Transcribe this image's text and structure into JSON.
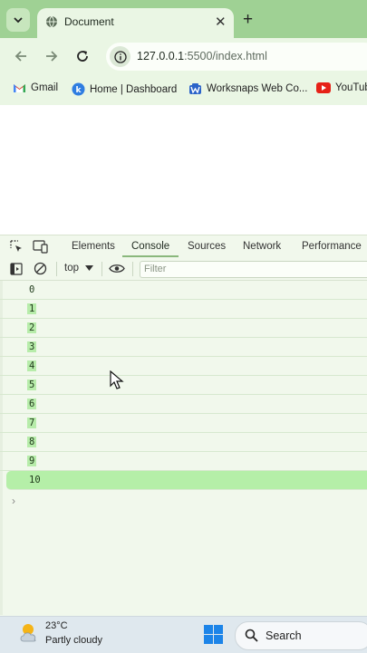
{
  "browser": {
    "tab_title": "Document",
    "url_host": "127.0.0.1",
    "url_rest": ":5500/index.html"
  },
  "bookmarks": [
    {
      "label": "Gmail",
      "icon": "gmail-icon"
    },
    {
      "label": "Home | Dashboard",
      "icon": "k-icon"
    },
    {
      "label": "Worksnaps Web Co...",
      "icon": "worksnaps-icon"
    },
    {
      "label": "YouTub",
      "icon": "youtube-icon"
    }
  ],
  "devtools": {
    "tabs": [
      "Elements",
      "Console",
      "Sources",
      "Network",
      "Performance"
    ],
    "active_tab": "Console",
    "context": "top",
    "filter_placeholder": "Filter"
  },
  "console": {
    "logs": [
      "0",
      "1",
      "2",
      "3",
      "4",
      "5",
      "6",
      "7",
      "8",
      "9",
      "10"
    ],
    "prompt": "›"
  },
  "taskbar": {
    "temperature": "23°C",
    "condition": "Partly cloudy",
    "search_label": "Search"
  }
}
